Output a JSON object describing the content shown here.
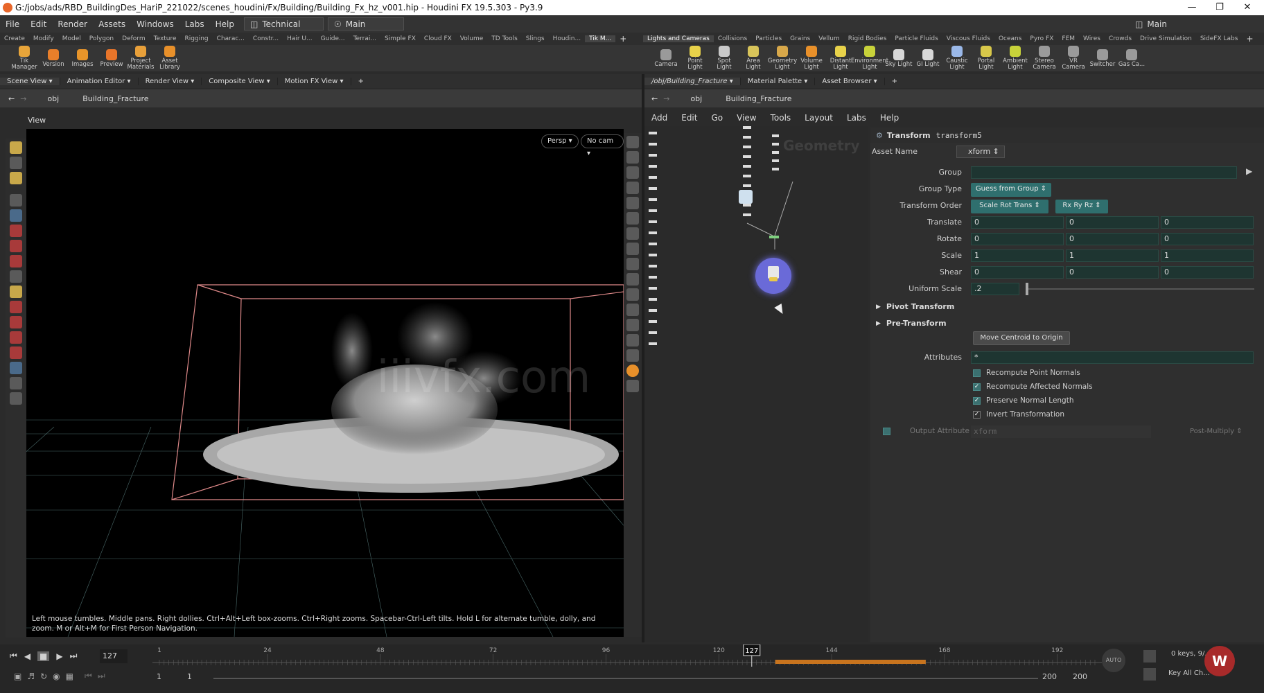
{
  "title": "G:/jobs/ads/RBD_BuildingDes_HariP_221022/scenes_houdini/Fx/Building/Building_Fx_hz_v001.hip - Houdini FX 19.5.303 - Py3.9",
  "menu": [
    "File",
    "Edit",
    "Render",
    "Assets",
    "Windows",
    "Labs",
    "Help"
  ],
  "desktop_left": "Technical",
  "desktop_mid": "Main",
  "desktop_right": "Main",
  "shelf_tabs_left": [
    "Create",
    "Modify",
    "Model",
    "Polygon",
    "Deform",
    "Texture",
    "Rigging",
    "Charac...",
    "Constr...",
    "Hair U...",
    "Guide...",
    "Terrai...",
    "Simple FX",
    "Cloud FX",
    "Volume",
    "TD Tools",
    "Slings",
    "Houdin...",
    "Tik M..."
  ],
  "shelf_tools_left": [
    {
      "label": "Tik Manager",
      "color": "#e8a53a"
    },
    {
      "label": "Version",
      "color": "#e87f2a"
    },
    {
      "label": "Images",
      "color": "#e8952a"
    },
    {
      "label": "Preview",
      "color": "#e8752a"
    },
    {
      "label": "Project Materials",
      "color": "#e8a03a"
    },
    {
      "label": "Asset Library",
      "color": "#e8902a"
    }
  ],
  "shelf_tabs_right": [
    "Lights and Cameras",
    "Collisions",
    "Particles",
    "Grains",
    "Vellum",
    "Rigid Bodies",
    "Particle Fluids",
    "Viscous Fluids",
    "Oceans",
    "Pyro FX",
    "FEM",
    "Wires",
    "Crowds",
    "Drive Simulation",
    "SideFX Labs"
  ],
  "shelf_tools_right": [
    {
      "label": "Camera",
      "color": "#9a9a9a"
    },
    {
      "label": "Point Light",
      "color": "#e8d24a"
    },
    {
      "label": "Spot Light",
      "color": "#c8c8c8"
    },
    {
      "label": "Area Light",
      "color": "#d8c45a"
    },
    {
      "label": "Geometry Light",
      "color": "#d8a84a"
    },
    {
      "label": "Volume Light",
      "color": "#e8902a"
    },
    {
      "label": "Distant Light",
      "color": "#e8d24a"
    },
    {
      "label": "Environment Light",
      "color": "#c8d23a"
    },
    {
      "label": "Sky Light",
      "color": "#d8d8d8"
    },
    {
      "label": "GI Light",
      "color": "#d8d8d8"
    },
    {
      "label": "Caustic Light",
      "color": "#9ab8e8"
    },
    {
      "label": "Portal Light",
      "color": "#d8c84a"
    },
    {
      "label": "Ambient Light",
      "color": "#c8d23a"
    },
    {
      "label": "Stereo Camera",
      "color": "#9a9a9a"
    },
    {
      "label": "VR Camera",
      "color": "#9a9a9a"
    },
    {
      "label": "Switcher",
      "color": "#9a9a9a"
    },
    {
      "label": "Gas Ca...",
      "color": "#9a9a9a"
    }
  ],
  "left_pane_tabs": [
    "Scene View",
    "Animation Editor",
    "Render View",
    "Composite View",
    "Motion FX View"
  ],
  "left_path": [
    "obj",
    "Building_Fracture"
  ],
  "viewport": {
    "label": "View",
    "persp": "Persp",
    "cam": "No cam",
    "hint": "Left mouse tumbles. Middle pans. Right dollies. Ctrl+Alt+Left box-zooms. Ctrl+Right zooms. Spacebar-Ctrl-Left tilts. Hold L for alternate tumble, dolly, and zoom.    M or Alt+M for First Person Navigation."
  },
  "right_pane_tabs": [
    "/obj/Building_Fracture",
    "Material Palette",
    "Asset Browser"
  ],
  "right_path": [
    "obj",
    "Building_Fracture"
  ],
  "network_menu": [
    "Add",
    "Edit",
    "Go",
    "View",
    "Tools",
    "Layout",
    "Labs",
    "Help"
  ],
  "network_watermark": "Geometry",
  "watermark": "iiivfx.com",
  "parms": {
    "node_type": "Transform",
    "node_name": "transform5",
    "asset_name_label": "Asset Name",
    "asset_name": "xform",
    "group_label": "Group",
    "group_value": "",
    "group_type_label": "Group Type",
    "group_type": "Guess from Group",
    "transform_order_label": "Transform Order",
    "transform_order": "Scale Rot Trans",
    "rot_order": "Rx Ry Rz",
    "translate_label": "Translate",
    "translate": [
      "0",
      "0",
      "0"
    ],
    "rotate_label": "Rotate",
    "rotate": [
      "0",
      "0",
      "0"
    ],
    "scale_label": "Scale",
    "scale": [
      "1",
      "1",
      "1"
    ],
    "shear_label": "Shear",
    "shear": [
      "0",
      "0",
      "0"
    ],
    "uniform_scale_label": "Uniform Scale",
    "uniform_scale": ".2",
    "uniform_scale_fraction": 0.0,
    "pivot_transform": "Pivot Transform",
    "pre_transform": "Pre-Transform",
    "move_centroid": "Move Centroid to Origin",
    "attributes_label": "Attributes",
    "attributes": "*",
    "checkboxes": [
      {
        "label": "Recompute Point Normals",
        "checked": false
      },
      {
        "label": "Recompute Affected Normals",
        "checked": true
      },
      {
        "label": "Preserve Normal Length",
        "checked": true
      },
      {
        "label": "Invert Transformation",
        "checked": true
      }
    ],
    "output_attribute_label": "Output Attribute",
    "output_attribute": "xform",
    "post_multiply": "Post-Multiply"
  },
  "timeline": {
    "current_frame": "127",
    "ticks": [
      "1",
      "24",
      "48",
      "72",
      "96",
      "120",
      "144",
      "168",
      "192"
    ],
    "marker": "127",
    "start": "1",
    "start2": "1",
    "end": "200",
    "end2": "200",
    "keys": "0 keys, 9/...",
    "key_all": "Key All Ch...",
    "auto": "AUTO"
  }
}
